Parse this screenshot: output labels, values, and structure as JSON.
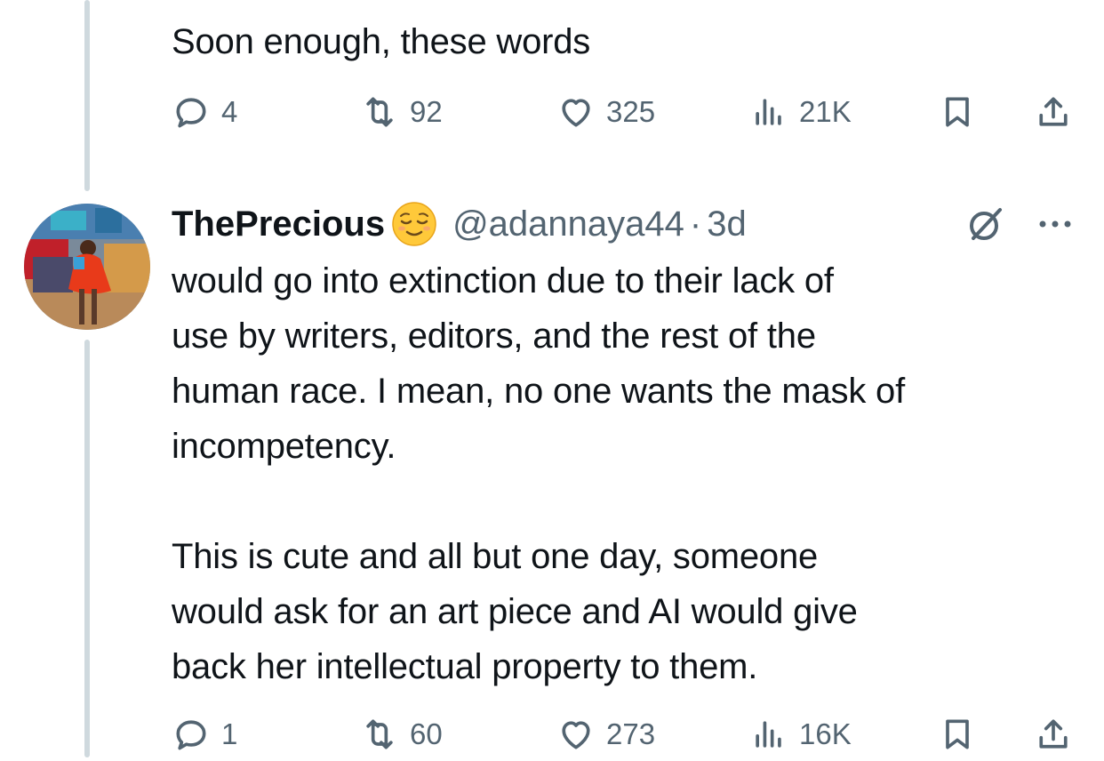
{
  "previous_tweet": {
    "text": "Soon enough, these words",
    "reply_count": "4",
    "retweet_count": "92",
    "like_count": "325",
    "view_count": "21K"
  },
  "tweet": {
    "display_name": "ThePrecious",
    "emoji": "relieved-face-emoji",
    "handle": "@adannaya44",
    "separator": "·",
    "time": "3d",
    "text": "would go into extinction due to their lack of\nuse by writers, editors, and the rest of the\nhuman race. I mean, no one wants the mask of\nincompetency.\n\nThis is cute and all but one day, someone\nwould ask for an art piece and AI would give\nback her intellectual property to them.",
    "reply_count": "1",
    "retweet_count": "60",
    "like_count": "273",
    "view_count": "16K"
  },
  "icons": {
    "reply": "reply-icon",
    "retweet": "retweet-icon",
    "like": "heart-icon",
    "views": "views-icon",
    "bookmark": "bookmark-icon",
    "share": "share-icon",
    "grok": "grok-icon",
    "more": "more-icon"
  },
  "colors": {
    "text_primary": "#0f1419",
    "text_secondary": "#536471",
    "thread_line": "#cfd9de",
    "background": "#ffffff"
  }
}
